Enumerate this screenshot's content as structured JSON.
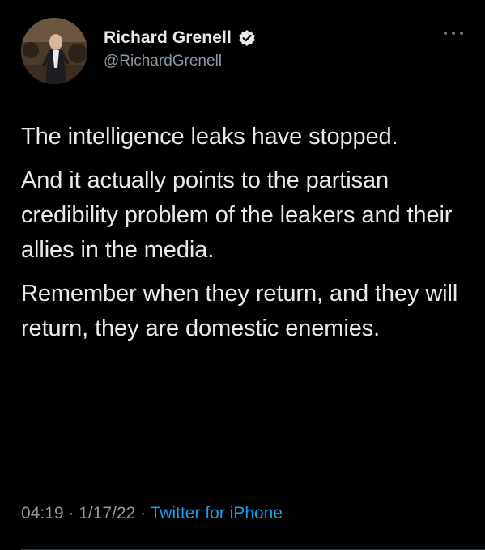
{
  "tweet": {
    "author": {
      "display_name": "Richard Grenell",
      "handle": "@RichardGrenell",
      "verified": true,
      "avatar_icon": "profile-photo"
    },
    "more_icon": "ellipsis-icon",
    "paragraphs": [
      "The intelligence leaks have stopped.",
      "And it actually points to the partisan credibility problem of the leakers and their allies in the media.",
      "Remember when they return, and they will return, they are domestic enemies."
    ],
    "meta": {
      "time": "04:19",
      "separator": "·",
      "date": "1/17/22",
      "source": "Twitter for iPhone"
    }
  },
  "colors": {
    "background": "#000000",
    "text": "#e7e9ea",
    "secondary_text": "#8b98a5",
    "link": "#1d9bf0",
    "verified_badge": "#1d9bf0"
  }
}
